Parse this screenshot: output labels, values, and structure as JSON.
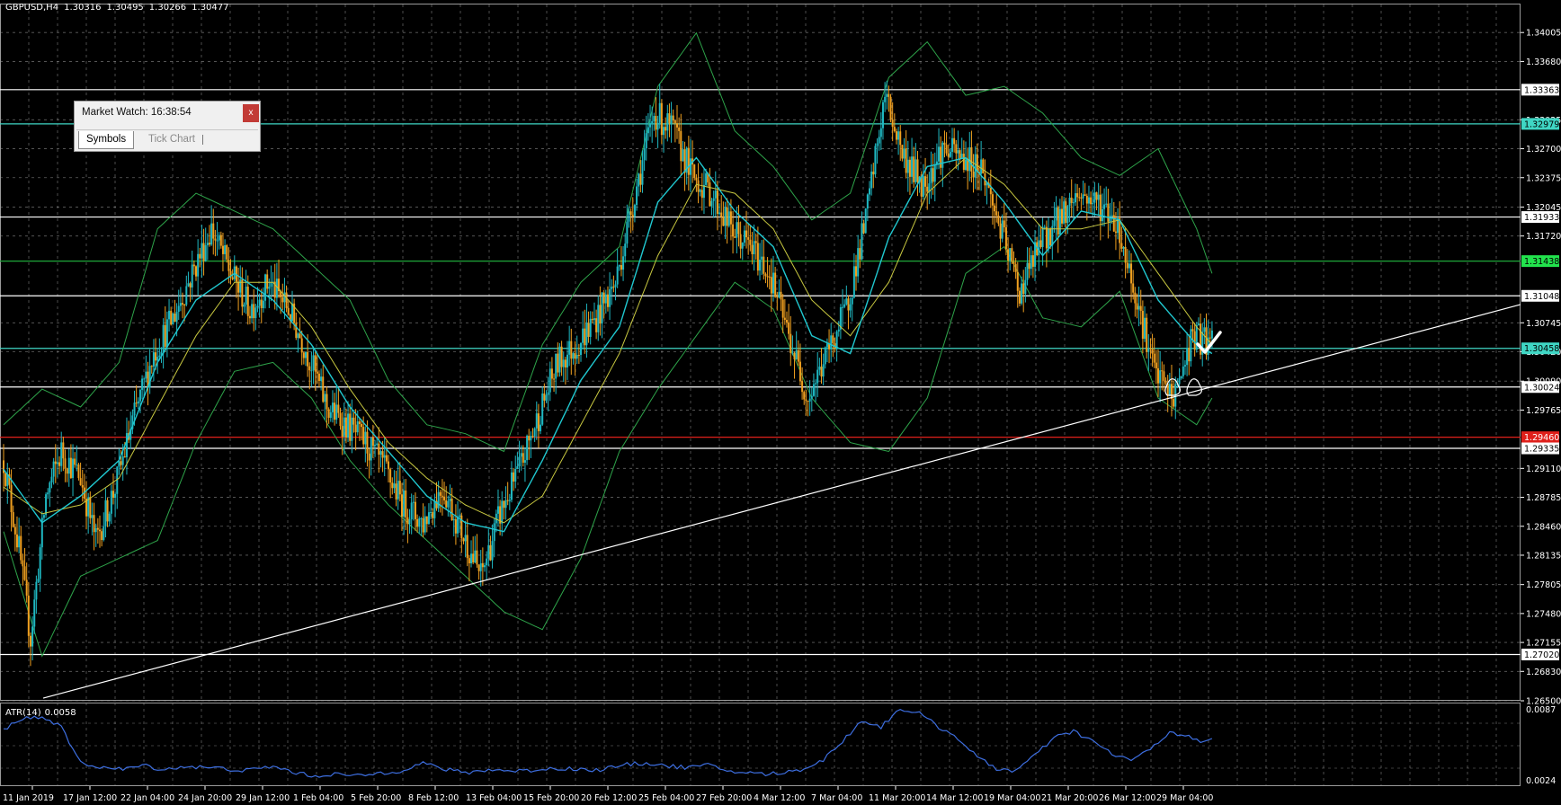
{
  "header": {
    "symbol": "GBPUSD,H4",
    "open": "1.30316",
    "high": "1.30495",
    "low": "1.30266",
    "close": "1.30477"
  },
  "atr": {
    "label": "ATR(14)",
    "value": "0.0058",
    "axis_top": "0.0087",
    "axis_bottom": "0.0024"
  },
  "market_watch": {
    "title": "Market Watch: 16:38:54",
    "close_label": "x",
    "tabs": [
      "Symbols",
      "Tick Chart"
    ]
  },
  "price_axis": {
    "min": 1.265,
    "max": 1.3433,
    "ticks": [
      "1.34005",
      "1.33680",
      "1.33025",
      "1.32700",
      "1.32375",
      "1.32045",
      "1.31720",
      "1.30745",
      "1.30420",
      "1.30090",
      "1.29765",
      "1.29110",
      "1.28785",
      "1.28460",
      "1.28135",
      "1.27805",
      "1.27480",
      "1.27155",
      "1.26830",
      "1.26500"
    ]
  },
  "levels": [
    {
      "label": "1.33363",
      "value": 1.33363,
      "color": "#ffffff",
      "box": "#ffffff",
      "text": "#000000"
    },
    {
      "label": "1.32979",
      "value": 1.32979,
      "color": "#3fd6c4",
      "box": "#3fd6c4",
      "text": "#000000"
    },
    {
      "label": "1.31933",
      "value": 1.31933,
      "color": "#ffffff",
      "box": "#ffffff",
      "text": "#000000"
    },
    {
      "label": "1.31438",
      "value": 1.31438,
      "color": "#1ea83a",
      "box": "#22e34d",
      "text": "#000000"
    },
    {
      "label": "1.31048",
      "value": 1.31048,
      "color": "#ffffff",
      "box": "#ffffff",
      "text": "#000000"
    },
    {
      "label": "1.30458",
      "value": 1.30458,
      "color": "#3fd6c4",
      "box": "#3fd6c4",
      "text": "#000000"
    },
    {
      "label": "1.30024",
      "value": 1.30024,
      "color": "#ffffff",
      "box": "#ffffff",
      "text": "#000000"
    },
    {
      "label": "1.29460",
      "value": 1.2946,
      "color": "#e0201b",
      "box": "#e0201b",
      "text": "#ffffff"
    },
    {
      "label": "1.29335",
      "value": 1.29335,
      "color": "#ffffff",
      "box": "#ffffff",
      "text": "#000000"
    },
    {
      "label": "1.27020",
      "value": 1.2702,
      "color": "#ffffff",
      "box": "#ffffff",
      "text": "#000000"
    }
  ],
  "time_axis": [
    "11 Jan 2019",
    "17 Jan 12:00",
    "22 Jan 04:00",
    "24 Jan 20:00",
    "29 Jan 12:00",
    "1 Feb 04:00",
    "5 Feb 20:00",
    "8 Feb 12:00",
    "13 Feb 04:00",
    "15 Feb 20:00",
    "20 Feb 12:00",
    "25 Feb 04:00",
    "27 Feb 20:00",
    "4 Mar 12:00",
    "7 Mar 04:00",
    "11 Mar 20:00",
    "14 Mar 12:00",
    "19 Mar 04:00",
    "21 Mar 20:00",
    "26 Mar 12:00",
    "29 Mar 04:00"
  ],
  "colors": {
    "bull": "#1fb8c2",
    "bear": "#f0a020",
    "grid": "#b0b0b0",
    "ma_fast": "#20c8d0",
    "ma_slow": "#c8c840",
    "bands": "#2ea44a",
    "atr_line": "#3d6ee0",
    "trendline": "#ffffff"
  },
  "chart_data": {
    "type": "candlestick",
    "symbol": "GBPUSD",
    "timeframe": "H4",
    "ylim": [
      1.265,
      1.3433
    ],
    "anchors": [
      [
        0,
        1.292
      ],
      [
        8,
        1.282
      ],
      [
        14,
        1.272
      ],
      [
        22,
        1.288
      ],
      [
        30,
        1.293
      ],
      [
        40,
        1.29
      ],
      [
        48,
        1.283
      ],
      [
        58,
        1.289
      ],
      [
        68,
        1.297
      ],
      [
        78,
        1.304
      ],
      [
        88,
        1.308
      ],
      [
        98,
        1.313
      ],
      [
        108,
        1.318
      ],
      [
        118,
        1.313
      ],
      [
        128,
        1.309
      ],
      [
        138,
        1.312
      ],
      [
        148,
        1.309
      ],
      [
        158,
        1.304
      ],
      [
        168,
        1.298
      ],
      [
        178,
        1.296
      ],
      [
        188,
        1.294
      ],
      [
        198,
        1.291
      ],
      [
        208,
        1.287
      ],
      [
        218,
        1.285
      ],
      [
        228,
        1.289
      ],
      [
        238,
        1.284
      ],
      [
        248,
        1.279
      ],
      [
        258,
        1.286
      ],
      [
        268,
        1.291
      ],
      [
        278,
        1.297
      ],
      [
        288,
        1.303
      ],
      [
        298,
        1.305
      ],
      [
        308,
        1.308
      ],
      [
        318,
        1.312
      ],
      [
        328,
        1.322
      ],
      [
        338,
        1.331
      ],
      [
        348,
        1.329
      ],
      [
        358,
        1.324
      ],
      [
        368,
        1.322
      ],
      [
        378,
        1.318
      ],
      [
        388,
        1.316
      ],
      [
        398,
        1.313
      ],
      [
        408,
        1.306
      ],
      [
        418,
        1.299
      ],
      [
        428,
        1.304
      ],
      [
        438,
        1.309
      ],
      [
        448,
        1.319
      ],
      [
        458,
        1.333
      ],
      [
        468,
        1.326
      ],
      [
        478,
        1.323
      ],
      [
        488,
        1.327
      ],
      [
        498,
        1.326
      ],
      [
        508,
        1.325
      ],
      [
        518,
        1.318
      ],
      [
        528,
        1.311
      ],
      [
        538,
        1.316
      ],
      [
        548,
        1.319
      ],
      [
        558,
        1.322
      ],
      [
        568,
        1.321
      ],
      [
        578,
        1.319
      ],
      [
        588,
        1.311
      ],
      [
        598,
        1.302
      ],
      [
        608,
        1.299
      ],
      [
        618,
        1.306
      ],
      [
        628,
        1.305
      ]
    ],
    "ma_fast": [
      [
        0,
        1.291
      ],
      [
        20,
        1.285
      ],
      [
        40,
        1.288
      ],
      [
        60,
        1.292
      ],
      [
        80,
        1.303
      ],
      [
        100,
        1.31
      ],
      [
        120,
        1.313
      ],
      [
        140,
        1.31
      ],
      [
        160,
        1.305
      ],
      [
        180,
        1.298
      ],
      [
        200,
        1.293
      ],
      [
        220,
        1.288
      ],
      [
        240,
        1.285
      ],
      [
        260,
        1.284
      ],
      [
        280,
        1.292
      ],
      [
        300,
        1.301
      ],
      [
        320,
        1.307
      ],
      [
        340,
        1.321
      ],
      [
        360,
        1.326
      ],
      [
        380,
        1.32
      ],
      [
        400,
        1.316
      ],
      [
        420,
        1.306
      ],
      [
        440,
        1.304
      ],
      [
        460,
        1.317
      ],
      [
        480,
        1.325
      ],
      [
        500,
        1.326
      ],
      [
        520,
        1.321
      ],
      [
        540,
        1.315
      ],
      [
        560,
        1.32
      ],
      [
        580,
        1.319
      ],
      [
        600,
        1.31
      ],
      [
        620,
        1.305
      ],
      [
        628,
        1.304
      ]
    ],
    "ma_slow": [
      [
        0,
        1.289
      ],
      [
        20,
        1.286
      ],
      [
        40,
        1.287
      ],
      [
        60,
        1.29
      ],
      [
        80,
        1.298
      ],
      [
        100,
        1.306
      ],
      [
        120,
        1.312
      ],
      [
        140,
        1.312
      ],
      [
        160,
        1.307
      ],
      [
        180,
        1.3
      ],
      [
        200,
        1.294
      ],
      [
        220,
        1.29
      ],
      [
        240,
        1.287
      ],
      [
        260,
        1.285
      ],
      [
        280,
        1.288
      ],
      [
        300,
        1.296
      ],
      [
        320,
        1.304
      ],
      [
        340,
        1.315
      ],
      [
        360,
        1.323
      ],
      [
        380,
        1.322
      ],
      [
        400,
        1.318
      ],
      [
        420,
        1.31
      ],
      [
        440,
        1.306
      ],
      [
        460,
        1.312
      ],
      [
        480,
        1.322
      ],
      [
        500,
        1.326
      ],
      [
        520,
        1.323
      ],
      [
        540,
        1.318
      ],
      [
        560,
        1.318
      ],
      [
        580,
        1.319
      ],
      [
        600,
        1.313
      ],
      [
        620,
        1.307
      ],
      [
        628,
        1.305
      ]
    ],
    "bb_upper": [
      [
        0,
        1.296
      ],
      [
        20,
        1.3
      ],
      [
        40,
        1.298
      ],
      [
        60,
        1.303
      ],
      [
        80,
        1.318
      ],
      [
        100,
        1.322
      ],
      [
        120,
        1.32
      ],
      [
        140,
        1.318
      ],
      [
        160,
        1.314
      ],
      [
        180,
        1.31
      ],
      [
        200,
        1.301
      ],
      [
        220,
        1.296
      ],
      [
        240,
        1.295
      ],
      [
        260,
        1.293
      ],
      [
        280,
        1.305
      ],
      [
        300,
        1.312
      ],
      [
        320,
        1.316
      ],
      [
        340,
        1.334
      ],
      [
        360,
        1.34
      ],
      [
        380,
        1.329
      ],
      [
        400,
        1.325
      ],
      [
        420,
        1.319
      ],
      [
        440,
        1.322
      ],
      [
        460,
        1.335
      ],
      [
        480,
        1.339
      ],
      [
        500,
        1.333
      ],
      [
        520,
        1.334
      ],
      [
        540,
        1.331
      ],
      [
        560,
        1.326
      ],
      [
        580,
        1.324
      ],
      [
        600,
        1.327
      ],
      [
        620,
        1.318
      ],
      [
        628,
        1.313
      ]
    ],
    "bb_lower": [
      [
        0,
        1.284
      ],
      [
        20,
        1.27
      ],
      [
        40,
        1.279
      ],
      [
        60,
        1.281
      ],
      [
        80,
        1.283
      ],
      [
        100,
        1.294
      ],
      [
        120,
        1.302
      ],
      [
        140,
        1.303
      ],
      [
        160,
        1.299
      ],
      [
        180,
        1.292
      ],
      [
        200,
        1.287
      ],
      [
        220,
        1.283
      ],
      [
        240,
        1.279
      ],
      [
        260,
        1.275
      ],
      [
        280,
        1.273
      ],
      [
        300,
        1.281
      ],
      [
        320,
        1.293
      ],
      [
        340,
        1.3
      ],
      [
        360,
        1.306
      ],
      [
        380,
        1.312
      ],
      [
        400,
        1.309
      ],
      [
        420,
        1.299
      ],
      [
        440,
        1.294
      ],
      [
        460,
        1.293
      ],
      [
        480,
        1.299
      ],
      [
        500,
        1.313
      ],
      [
        520,
        1.316
      ],
      [
        540,
        1.308
      ],
      [
        560,
        1.307
      ],
      [
        580,
        1.311
      ],
      [
        600,
        1.299
      ],
      [
        620,
        1.296
      ],
      [
        628,
        1.299
      ]
    ],
    "trendline": {
      "start": [
        44,
        1.2653
      ],
      "end": [
        790,
        1.3095
      ]
    },
    "atr": [
      [
        0,
        0.0067
      ],
      [
        8,
        0.0077
      ],
      [
        16,
        0.0079
      ],
      [
        24,
        0.0077
      ],
      [
        30,
        0.0069
      ],
      [
        40,
        0.0037
      ],
      [
        52,
        0.0033
      ],
      [
        62,
        0.0031
      ],
      [
        72,
        0.0035
      ],
      [
        84,
        0.0031
      ],
      [
        94,
        0.0034
      ],
      [
        104,
        0.0033
      ],
      [
        114,
        0.0032
      ],
      [
        126,
        0.003
      ],
      [
        140,
        0.0034
      ],
      [
        150,
        0.0029
      ],
      [
        160,
        0.0025
      ],
      [
        172,
        0.0027
      ],
      [
        184,
        0.0025
      ],
      [
        196,
        0.0028
      ],
      [
        206,
        0.003
      ],
      [
        218,
        0.0037
      ],
      [
        230,
        0.0031
      ],
      [
        240,
        0.0028
      ],
      [
        252,
        0.0031
      ],
      [
        262,
        0.003
      ],
      [
        272,
        0.003
      ],
      [
        284,
        0.0032
      ],
      [
        296,
        0.0032
      ],
      [
        306,
        0.003
      ],
      [
        316,
        0.0033
      ],
      [
        326,
        0.0036
      ],
      [
        336,
        0.0037
      ],
      [
        346,
        0.0034
      ],
      [
        356,
        0.0033
      ],
      [
        366,
        0.0035
      ],
      [
        376,
        0.003
      ],
      [
        386,
        0.0028
      ],
      [
        396,
        0.0027
      ],
      [
        406,
        0.0028
      ],
      [
        416,
        0.0032
      ],
      [
        426,
        0.004
      ],
      [
        436,
        0.0057
      ],
      [
        446,
        0.0076
      ],
      [
        456,
        0.007
      ],
      [
        466,
        0.0087
      ],
      [
        476,
        0.0082
      ],
      [
        486,
        0.007
      ],
      [
        496,
        0.006
      ],
      [
        506,
        0.0042
      ],
      [
        516,
        0.0032
      ],
      [
        526,
        0.003
      ],
      [
        536,
        0.0044
      ],
      [
        546,
        0.006
      ],
      [
        556,
        0.0066
      ],
      [
        566,
        0.0057
      ],
      [
        576,
        0.0045
      ],
      [
        586,
        0.004
      ],
      [
        596,
        0.0049
      ],
      [
        606,
        0.0066
      ],
      [
        614,
        0.0062
      ],
      [
        622,
        0.0056
      ],
      [
        628,
        0.0058
      ]
    ]
  }
}
